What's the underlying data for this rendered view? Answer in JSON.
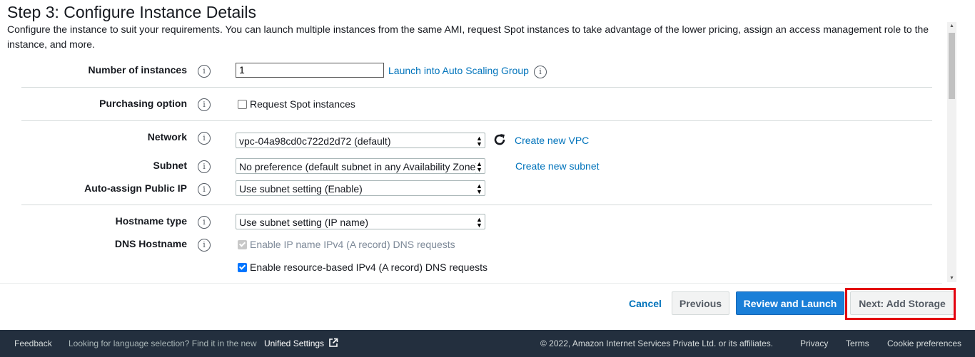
{
  "page": {
    "title": "Step 3: Configure Instance Details",
    "description": "Configure the instance to suit your requirements. You can launch multiple instances from the same AMI, request Spot instances to take advantage of the lower pricing, assign an access management role to the instance, and more."
  },
  "form": {
    "number_of_instances": {
      "label": "Number of instances",
      "value": "1",
      "link": "Launch into Auto Scaling Group"
    },
    "purchasing_option": {
      "label": "Purchasing option",
      "checkbox_label": "Request Spot instances"
    },
    "network": {
      "label": "Network",
      "value": "vpc-04a98cd0c722d2d72 (default)",
      "link": "Create new VPC"
    },
    "subnet": {
      "label": "Subnet",
      "value": "No preference (default subnet in any Availability Zone)",
      "link": "Create new subnet"
    },
    "auto_assign_ip": {
      "label": "Auto-assign Public IP",
      "value": "Use subnet setting (Enable)"
    },
    "hostname_type": {
      "label": "Hostname type",
      "value": "Use subnet setting (IP name)"
    },
    "dns_hostname": {
      "label": "DNS Hostname",
      "option1": "Enable IP name IPv4 (A record) DNS requests",
      "option2": "Enable resource-based IPv4 (A record) DNS requests"
    },
    "info_glyph": "i"
  },
  "actions": {
    "cancel": "Cancel",
    "previous": "Previous",
    "review_launch": "Review and Launch",
    "next": "Next: Add Storage"
  },
  "footer": {
    "feedback": "Feedback",
    "language_note": "Looking for language selection? Find it in the new",
    "unified_settings": "Unified Settings",
    "copyright": "© 2022, Amazon Internet Services Private Ltd. or its affiliates.",
    "privacy": "Privacy",
    "terms": "Terms",
    "cookie": "Cookie preferences"
  },
  "icons": {
    "refresh": "refresh-icon",
    "external": "external-link-icon",
    "info": "info-icon"
  },
  "colors": {
    "link": "#0073bb",
    "primary_button": "#1a7fd8",
    "footer_bg": "#232f3e",
    "highlight": "#e3000f"
  }
}
